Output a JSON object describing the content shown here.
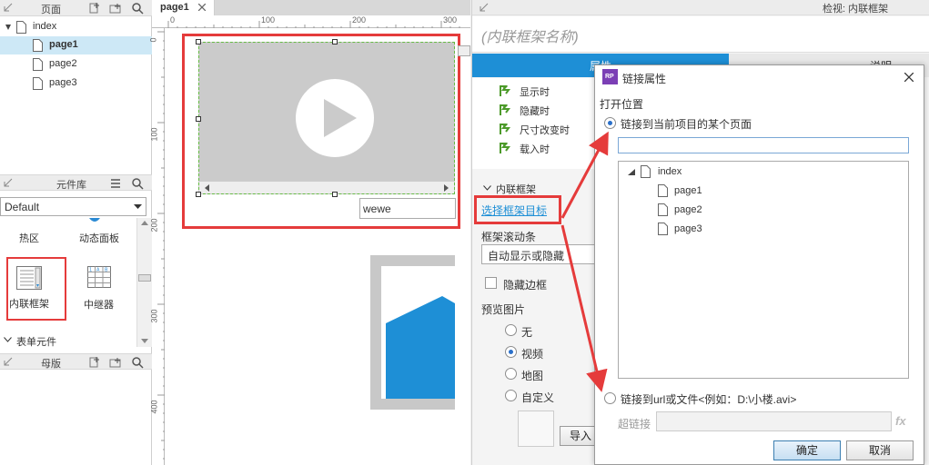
{
  "left_panel": {
    "pages_header": "页面",
    "pages": [
      {
        "label": "index"
      },
      {
        "label": "page1",
        "selected": true
      },
      {
        "label": "page2"
      },
      {
        "label": "page3"
      }
    ],
    "library_header": "元件库",
    "library_select": "Default",
    "widgets": {
      "hotspot": "热区",
      "dynamic_panel": "动态面板",
      "inline_frame": "内联框架",
      "repeater": "中继器"
    },
    "form_section": "表单元件",
    "masters_header": "母版"
  },
  "canvas": {
    "tab_label": "page1",
    "ruler_h": [
      "0",
      "100",
      "200",
      "300"
    ],
    "ruler_v": [
      "0",
      "100",
      "200",
      "300",
      "400"
    ],
    "text_field_value": "wewe"
  },
  "right_panel": {
    "header_title": "检视: 内联框架",
    "widget_name_placeholder": "(内联框架名称)",
    "tab_left": "属性",
    "tab_right": "说明",
    "events": [
      "显示时",
      "隐藏时",
      "尺寸改变时",
      "载入时"
    ],
    "section_label": "内联框架",
    "choose_target_link": "选择框架目标",
    "scroll_label": "框架滚动条",
    "scroll_value": "自动显示或隐藏",
    "hide_border_label": "隐藏边框",
    "preview_label": "预览图片",
    "preview_options": [
      "无",
      "视频",
      "地图",
      "自定义"
    ],
    "preview_selected": "视频",
    "import_button": "导入"
  },
  "dialog": {
    "title": "链接属性",
    "app_icon_text": "RP",
    "open_location_label": "打开位置",
    "option_page": "链接到当前项目的某个页面",
    "option_url": "链接到url或文件<例如：D:\\小楼.avi>",
    "tree": [
      {
        "label": "index",
        "level": 0
      },
      {
        "label": "page1",
        "level": 1
      },
      {
        "label": "page2",
        "level": 1
      },
      {
        "label": "page3",
        "level": 1
      }
    ],
    "hyperlink_label": "超链接",
    "fx_label": "fx",
    "ok_button": "确定",
    "cancel_button": "取消"
  },
  "colors": {
    "accent_blue": "#1e8fd6",
    "highlight_red": "#e53b3b",
    "selection": "#cde8f6",
    "event_green": "#4c9a2a"
  }
}
